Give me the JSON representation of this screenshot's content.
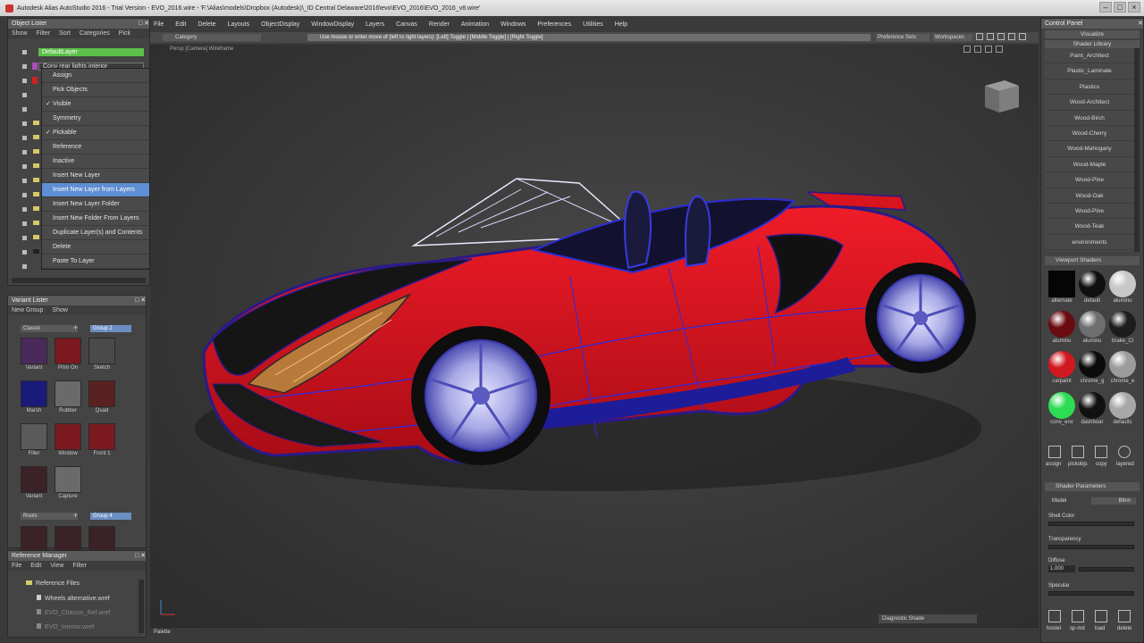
{
  "app": {
    "title": "Autodesk Alias AutoStudio 2016 - Trial Version - EVO_2016.wire - 'F:\\Alias\\models\\Dropbox (Autodesk)\\_ID Central Delaware\\2016\\evo\\EVO_2016\\EVO_2016_v8.wire'",
    "window_buttons": [
      "–",
      "□",
      "×"
    ]
  },
  "object_lister": {
    "title": "Object Lister",
    "menu": [
      "Show",
      "Filter",
      "Sort",
      "Categories",
      "Pick"
    ],
    "layers": [
      {
        "label": "DefaultLayer",
        "color": "#5cc04a"
      },
      {
        "label": "Conv rear lights interior",
        "color": "#a84fb8"
      }
    ],
    "context_menu": [
      {
        "label": "Assign",
        "checked": false,
        "highlight": false
      },
      {
        "label": "Pick Objects",
        "checked": false,
        "highlight": false
      },
      {
        "label": "Visible",
        "checked": true,
        "highlight": false
      },
      {
        "label": "Symmetry",
        "checked": false,
        "highlight": false
      },
      {
        "label": "Pickable",
        "checked": true,
        "highlight": false
      },
      {
        "label": "Reference",
        "checked": false,
        "highlight": false
      },
      {
        "label": "Inactive",
        "checked": false,
        "highlight": false
      },
      {
        "label": "Insert New Layer",
        "checked": false,
        "highlight": false
      },
      {
        "label": "Insert New Layer from Layers",
        "checked": false,
        "highlight": true
      },
      {
        "label": "Insert New Layer Folder",
        "checked": false,
        "highlight": false
      },
      {
        "label": "Insert New Folder From Layers",
        "checked": false,
        "highlight": false
      },
      {
        "label": "Duplicate Layer(s) and Contents",
        "checked": false,
        "highlight": false
      },
      {
        "label": "Delete",
        "checked": false,
        "highlight": false
      },
      {
        "label": "Paste To Layer",
        "checked": false,
        "highlight": false
      }
    ]
  },
  "variant_lister": {
    "title": "Variant Lister",
    "menu": [
      "New Group",
      "Show"
    ],
    "group1": "Classic",
    "group1_field": "Group 2",
    "items": [
      "Variant",
      "Prim On",
      "Sketch",
      "Marsh",
      "Rubber",
      "Quad",
      "Filler",
      "Window",
      "Front 1",
      "Variant",
      "Capture"
    ],
    "group2": "Roots",
    "group2_field": "Group 4"
  },
  "reference_manager": {
    "title": "Reference Manager",
    "menu": [
      "File",
      "Edit",
      "View",
      "Filter"
    ],
    "root": "Reference Files",
    "files": [
      "Wheels alternative.wref",
      "EVO_Chassis_Ref.wref",
      "EVO_Interior.wref"
    ]
  },
  "main_menu": [
    "File",
    "Edit",
    "Delete",
    "Layouts",
    "ObjectDisplay",
    "WindowDisplay",
    "Layers",
    "Canvas",
    "Render",
    "Animation",
    "Windows",
    "Preferences",
    "Utilities",
    "Help"
  ],
  "toolbar": {
    "category_label": "Category",
    "prompt": "Use mouse or enter move of (left to right layers): [Left] Toggle | [Middle Toggle] | [Right Toggle]",
    "preference_sets": "Preference Sets",
    "workspaces": "Workspaces"
  },
  "viewport": {
    "label": "Persp [Camera]  Wireframe",
    "diagnostic": "Diagnostic Shade",
    "palette": "Palette"
  },
  "control_panel": {
    "title": "Control Panel",
    "tabs": [
      "Visualize",
      "Shader Library"
    ],
    "library": [
      "Paint_Architect",
      "Plastic_Laminate",
      "Plastics",
      "Wood-Architect",
      "Wood-Birch",
      "Wood-Cherry",
      "Wood-Mahogany",
      "Wood-Maple",
      "Wood-Pine",
      "Wood-Oak",
      "Wood-Pine",
      "Wood-Teak",
      "environments"
    ],
    "viewport_shader_title": "Viewport Shaders",
    "shaders": [
      {
        "label": "alternate",
        "color": "#050505"
      },
      {
        "label": "default",
        "color": "#101010"
      },
      {
        "label": "aluminu",
        "color": "#c8c8c8"
      },
      {
        "label": "aluminu",
        "color": "#6a0b10"
      },
      {
        "label": "aluminu",
        "color": "#6e6e6e"
      },
      {
        "label": "brake_Cl",
        "color": "#1d1d1d"
      },
      {
        "label": "carpaint",
        "color": "#d11820"
      },
      {
        "label": "chrome_g",
        "color": "#0b0b0b"
      },
      {
        "label": "chrome_e",
        "color": "#9c9c9c"
      },
      {
        "label": "conv_env",
        "color": "#2cdc52"
      },
      {
        "label": "dashboar",
        "color": "#111111"
      },
      {
        "label": "defaults",
        "color": "#a8a8a8"
      }
    ],
    "tools": [
      "assign",
      "pickobjs",
      "copy",
      "layered"
    ],
    "params_title": "Shader Parameters",
    "model_label": "Model",
    "model_value": "Blinn",
    "params": [
      {
        "label": "Shell Color",
        "value": ""
      },
      {
        "label": "Transparency",
        "value": ""
      },
      {
        "label": "Diffuse",
        "value": "1.000"
      },
      {
        "label": "Specular",
        "value": ""
      }
    ],
    "bottom_tools": [
      "hostel",
      "sp-md",
      "load",
      "delete"
    ]
  },
  "colors": {
    "selection": "#5e8ed4",
    "car_paint": "#d8141e",
    "wire": "#1f2bd8"
  }
}
